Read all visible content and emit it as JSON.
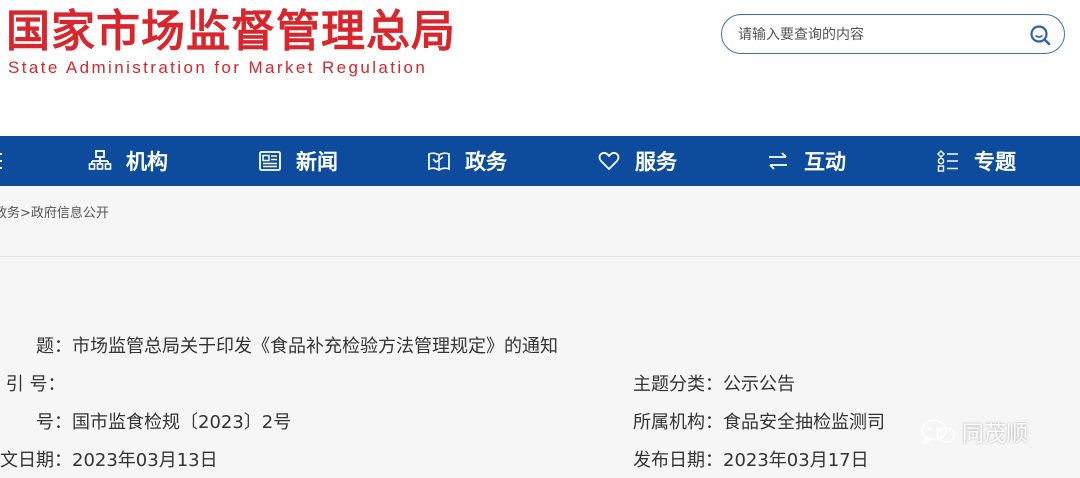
{
  "header": {
    "logo_cn": "国家市场监督管理总局",
    "logo_en": "State Administration for Market Regulation",
    "search_placeholder": "请输入要查询的内容"
  },
  "nav": {
    "items": [
      {
        "label": "机构",
        "icon": "org-chart-icon"
      },
      {
        "label": "新闻",
        "icon": "news-icon"
      },
      {
        "label": "政务",
        "icon": "government-book-icon"
      },
      {
        "label": "服务",
        "icon": "heart-icon"
      },
      {
        "label": "互动",
        "icon": "exchange-arrows-icon"
      },
      {
        "label": "专题",
        "icon": "topics-list-icon"
      }
    ],
    "colors": {
      "background": "#0d4c9c",
      "text": "#ffffff"
    }
  },
  "breadcrumb": {
    "items": [
      "政务",
      "政府信息公开"
    ],
    "separator": ">"
  },
  "document": {
    "title_label": "标　　题",
    "title_value": "市场监管总局关于印发《食品补充检验方法管理规定》的通知",
    "index_label": "索 引 号",
    "index_value": "",
    "doc_no_label": "文　　号",
    "doc_no_value": "国市监食检规〔2023〕2号",
    "date_written_label": "成文日期",
    "date_written_value": "2023年03月13日",
    "category_label": "主题分类",
    "category_value": "公示公告",
    "org_label": "所属机构",
    "org_value": "食品安全抽检监测司",
    "publish_label": "发布日期",
    "publish_value": "2023年03月17日",
    "colon": "："
  },
  "watermark": {
    "text": "同茂顺",
    "icon": "wechat-icon"
  },
  "colors": {
    "brand_red": "#d8262c",
    "nav_blue": "#0d4c9c",
    "search_border": "#3c6fb5"
  }
}
